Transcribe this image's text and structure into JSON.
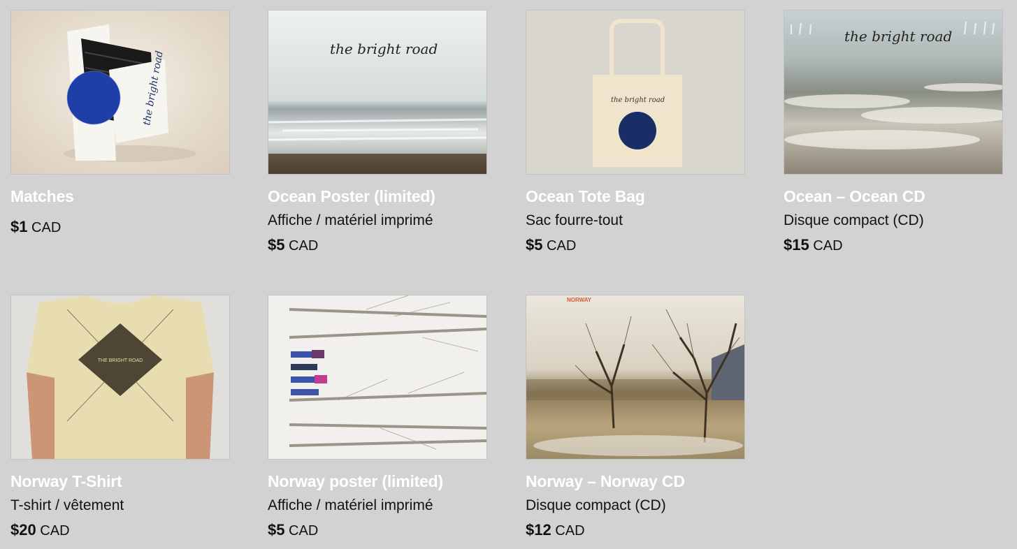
{
  "products": [
    {
      "title": "Matches",
      "subtitle": "",
      "amount": "$1",
      "currency": "CAD",
      "image": "matchbook-image"
    },
    {
      "title": "Ocean Poster (limited)",
      "subtitle": "Affiche / matériel imprimé",
      "amount": "$5",
      "currency": "CAD",
      "image": "ocean-poster-image"
    },
    {
      "title": "Ocean Tote Bag",
      "subtitle": "Sac fourre-tout",
      "amount": "$5",
      "currency": "CAD",
      "image": "tote-bag-image"
    },
    {
      "title": "Ocean – Ocean CD",
      "subtitle": "Disque compact (CD)",
      "amount": "$15",
      "currency": "CAD",
      "image": "ocean-cd-image"
    },
    {
      "title": "Norway T-Shirt",
      "subtitle": "T-shirt / vêtement",
      "amount": "$20",
      "currency": "CAD",
      "image": "tshirt-image"
    },
    {
      "title": "Norway poster (limited)",
      "subtitle": "Affiche / matériel imprimé",
      "amount": "$5",
      "currency": "CAD",
      "image": "norway-poster-image"
    },
    {
      "title": "Norway – Norway CD",
      "subtitle": "Disque compact (CD)",
      "amount": "$12",
      "currency": "CAD",
      "image": "norway-cd-image"
    }
  ],
  "artwork_text": {
    "handwritten": "the bright road",
    "tshirt_print": "THE BRIGHT ROAD",
    "norway_cd_label": "NORWAY"
  },
  "colors": {
    "background": "#d2d2d2",
    "title": "#ffffff",
    "text": "#111111",
    "navy": "#1b2f6b"
  }
}
